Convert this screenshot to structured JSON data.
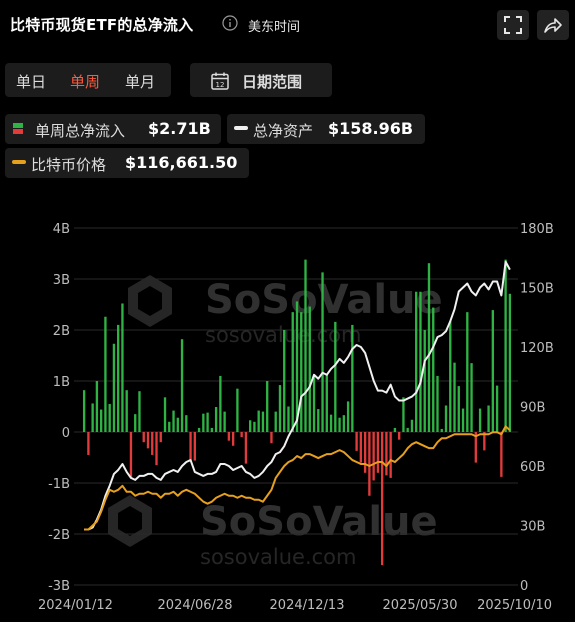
{
  "header": {
    "title": "比特币现货ETF的总净流入",
    "timezone": "美东时间"
  },
  "periods": [
    {
      "label": "单日",
      "active": false
    },
    {
      "label": "单周",
      "active": true
    },
    {
      "label": "单月",
      "active": false
    }
  ],
  "date_range_label": "日期范围",
  "date_range_icon_day": "12",
  "legend": {
    "flow": {
      "label": "单周总净流入",
      "value": "$2.71B"
    },
    "assets": {
      "label": "总净资产",
      "value": "$158.96B"
    },
    "price": {
      "label": "比特币价格",
      "value": "$116,661.50"
    }
  },
  "watermark": {
    "brand": "SoSoValue",
    "url": "sosovalue.com"
  },
  "colors": {
    "inflow": "#2fb344",
    "outflow": "#e23b3b",
    "assets_line": "#f0f0f0",
    "price_line": "#e6a01e",
    "active_tab": "#ff5a3c",
    "background": "#000000"
  },
  "chart_data": {
    "type": "bar",
    "y_left": {
      "range": [
        -3,
        4
      ],
      "unit": "B",
      "ticks": [
        "4B",
        "3B",
        "2B",
        "1B",
        "0",
        "-1B",
        "-2B",
        "-3B"
      ]
    },
    "y_right": {
      "range": [
        0,
        180
      ],
      "unit": "B",
      "ticks": [
        "180B",
        "150B",
        "120B",
        "90B",
        "60B",
        "30B",
        "0"
      ]
    },
    "x_tick_labels": [
      "2024/01/12",
      "2024/06/28",
      "2024/12/13",
      "2025/05/30",
      "2025/10/10"
    ],
    "weekly_net_inflow_B": [
      0.82,
      -0.45,
      0.56,
      1.0,
      0.44,
      2.26,
      0.55,
      1.73,
      2.1,
      2.52,
      0.82,
      -0.9,
      0.35,
      0.8,
      -0.2,
      -0.32,
      -0.45,
      -0.65,
      -0.2,
      0.68,
      0.2,
      0.42,
      0.28,
      1.82,
      0.33,
      -0.58,
      -0.56,
      0.08,
      0.36,
      0.38,
      0.08,
      0.49,
      1.1,
      0.4,
      -0.17,
      -0.27,
      0.85,
      -0.1,
      -0.62,
      0.23,
      0.2,
      0.42,
      0.4,
      1.0,
      -0.22,
      0.4,
      0.92,
      2.0,
      0.5,
      2.35,
      2.56,
      2.35,
      3.38,
      2.46,
      1.1,
      0.45,
      3.13,
      1.14,
      0.34,
      2.16,
      0.28,
      0.33,
      0.6,
      2.1,
      -0.37,
      -0.6,
      -0.8,
      -1.25,
      -0.95,
      -0.8,
      -2.61,
      -0.85,
      -0.9,
      0.08,
      -0.15,
      0.68,
      0.08,
      0.24,
      2.75,
      2.75,
      2.0,
      3.31,
      2.44,
      1.1,
      0.06,
      0.52,
      2.17,
      1.36,
      0.9,
      0.46,
      2.35,
      1.35,
      -0.6,
      0.46,
      -0.36,
      0.52,
      2.39,
      0.91,
      -0.88,
      3.38,
      2.71
    ],
    "series": [
      {
        "name": "总净资产",
        "axis": "right",
        "unit": "B",
        "values": [
          28,
          28,
          29,
          33,
          38,
          45,
          50,
          56,
          58,
          61,
          57,
          54,
          53,
          55,
          55,
          56,
          56,
          54,
          53,
          56,
          57,
          58,
          57,
          60,
          62,
          63,
          57,
          56,
          55,
          56,
          56,
          57,
          61,
          61,
          60,
          58,
          59,
          60,
          57,
          56,
          54,
          55,
          57,
          60,
          62,
          66,
          67,
          70,
          75,
          79,
          83,
          95,
          97,
          100,
          106,
          104,
          107,
          106,
          109,
          111,
          114,
          112,
          115,
          119,
          121,
          120,
          117,
          110,
          103,
          98,
          98,
          97,
          101,
          95,
          93,
          93,
          94,
          95,
          97,
          102,
          113,
          116,
          120,
          125,
          126,
          128,
          133,
          139,
          148,
          150,
          152,
          148,
          146,
          150,
          152,
          149,
          153,
          153,
          146,
          163,
          159
        ]
      },
      {
        "name": "比特币价格",
        "axis": "right",
        "unit": "B-axis scale",
        "values": [
          28,
          28,
          30,
          32,
          37,
          43,
          48,
          47,
          48,
          50,
          47,
          47,
          45,
          46,
          46,
          47,
          46,
          46,
          44,
          46,
          46,
          47,
          45,
          47,
          48,
          47,
          46,
          44,
          42,
          41,
          42,
          44,
          45,
          46,
          45,
          45,
          44,
          45,
          44,
          44,
          43,
          43,
          42,
          45,
          48,
          54,
          57,
          60,
          62,
          63,
          65,
          64,
          66,
          66,
          65,
          64,
          65,
          66,
          66,
          67,
          68,
          67,
          65,
          63,
          62,
          61,
          61,
          60,
          61,
          62,
          62,
          60,
          63,
          62,
          64,
          66,
          69,
          71,
          72,
          71,
          70,
          69,
          69,
          72,
          74,
          74,
          75,
          76,
          76,
          76,
          76,
          76,
          75,
          76,
          76,
          76,
          77,
          77,
          76,
          80,
          78
        ]
      }
    ]
  }
}
